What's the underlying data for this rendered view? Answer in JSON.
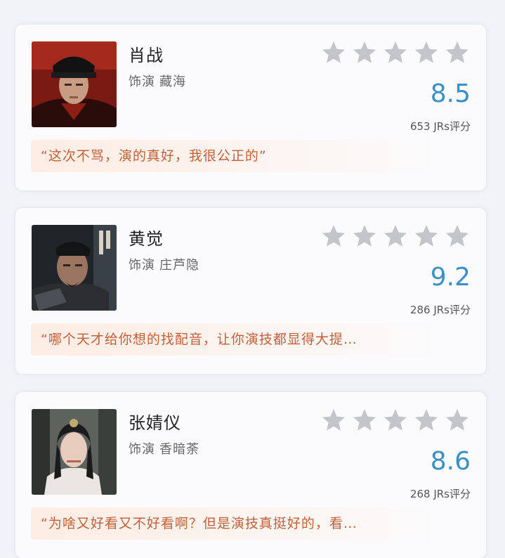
{
  "cards": [
    {
      "name": "肖战",
      "role_prefix": "饰演",
      "role_name": "藏海",
      "rating": 0,
      "score": "8.5",
      "count": "653 JRs评分",
      "quote": "“这次不骂，演的真好，我很公正的”"
    },
    {
      "name": "黄觉",
      "role_prefix": "饰演",
      "role_name": "庄芦隐",
      "rating": 0,
      "score": "9.2",
      "count": "286 JRs评分",
      "quote": "“哪个天才给你想的找配音，让你演技都显得大提…"
    },
    {
      "name": "张婧仪",
      "role_prefix": "饰演",
      "role_name": "香暗荼",
      "rating": 0,
      "score": "8.6",
      "count": "268 JRs评分",
      "quote": "“为啥又好看又不好看啊？但是演技真挺好的，看…"
    }
  ],
  "colors": {
    "star": "#c3c5ca",
    "score": "#3a8fc4",
    "quote_text": "#c0603a"
  }
}
